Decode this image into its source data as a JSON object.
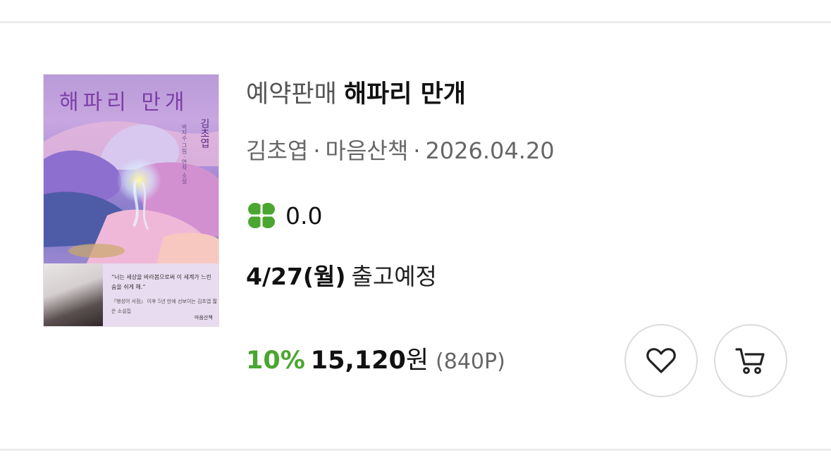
{
  "book": {
    "sale_tag": "예약판매",
    "title": "해파리 만개",
    "author": "김초엽",
    "separator": "·",
    "publisher": "마음산책",
    "date": "2026.04.20",
    "rating": "0.0",
    "ship_date": "4/27(월)",
    "ship_label": "출고예정",
    "discount": "10%",
    "price": "15,120",
    "currency": "원",
    "points": "(840P)"
  },
  "cover": {
    "title": "해파리 만개",
    "author": "김초엽",
    "subtitle": "박지수 그림 · 연작 소설",
    "quote": "“너는 세상을 바라봄으로써 이 세계가 느린 숨을 쉬게 해.”",
    "blurb": "『행성어 서점』 이후 5년 만에 선보이는 김초엽 짧은 소설집",
    "publisher": "마음산책"
  },
  "icons": {
    "rating": "clover-icon",
    "wishlist": "heart-icon",
    "cart": "cart-icon"
  },
  "colors": {
    "discount": "#4aa62f",
    "clover": "#4aa62f",
    "divider": "#ececec"
  }
}
